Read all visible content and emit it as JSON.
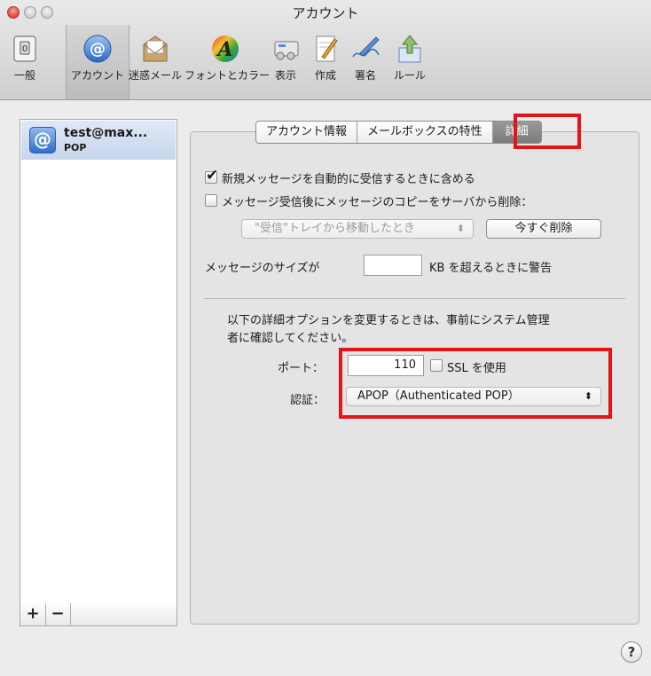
{
  "window": {
    "title": "アカウント"
  },
  "toolbar": {
    "items": [
      {
        "label": "一般",
        "icon": "switch-icon"
      },
      {
        "label": "アカウント",
        "icon": "at-sign-icon",
        "selected": true
      },
      {
        "label": "迷惑メール",
        "icon": "junk-mail-icon"
      },
      {
        "label": "フォントとカラー",
        "icon": "font-icon"
      },
      {
        "label": "表示",
        "icon": "view-icon"
      },
      {
        "label": "作成",
        "icon": "compose-icon"
      },
      {
        "label": "署名",
        "icon": "signature-icon"
      },
      {
        "label": "ルール",
        "icon": "rules-icon"
      }
    ]
  },
  "accounts": [
    {
      "name": "test@max...",
      "type": "POP",
      "icon": "at-sign-icon"
    }
  ],
  "list_buttons": {
    "add": "+",
    "remove": "−"
  },
  "tabs": [
    {
      "label": "アカウント情報"
    },
    {
      "label": "メールボックスの特性"
    },
    {
      "label": "詳細",
      "active": true
    }
  ],
  "advanced": {
    "include_auto_fetch_label": "新規メッセージを自動的に受信するときに含める",
    "include_auto_fetch_checked": true,
    "remove_copy_label": "メッセージ受信後にメッセージのコピーをサーバから削除：",
    "remove_copy_checked": false,
    "remove_when_value": "\"受信\"トレイから移動したとき",
    "remove_now_button": "今すぐ削除",
    "size_warning_prefix": "メッセージのサイズが",
    "size_warning_value": "",
    "size_warning_suffix": "KB を超えるときに警告",
    "admin_note_line1": "以下の詳細オプションを変更するときは、事前にシステム管理",
    "admin_note_line2": "者に確認してください。",
    "port_label": "ポート：",
    "port_value": "110",
    "ssl_label": "SSL を使用",
    "ssl_checked": false,
    "auth_label": "認証：",
    "auth_value": "APOP（Authenticated POP）"
  },
  "help": {
    "label": "?"
  },
  "highlight_color": "#e3141a"
}
